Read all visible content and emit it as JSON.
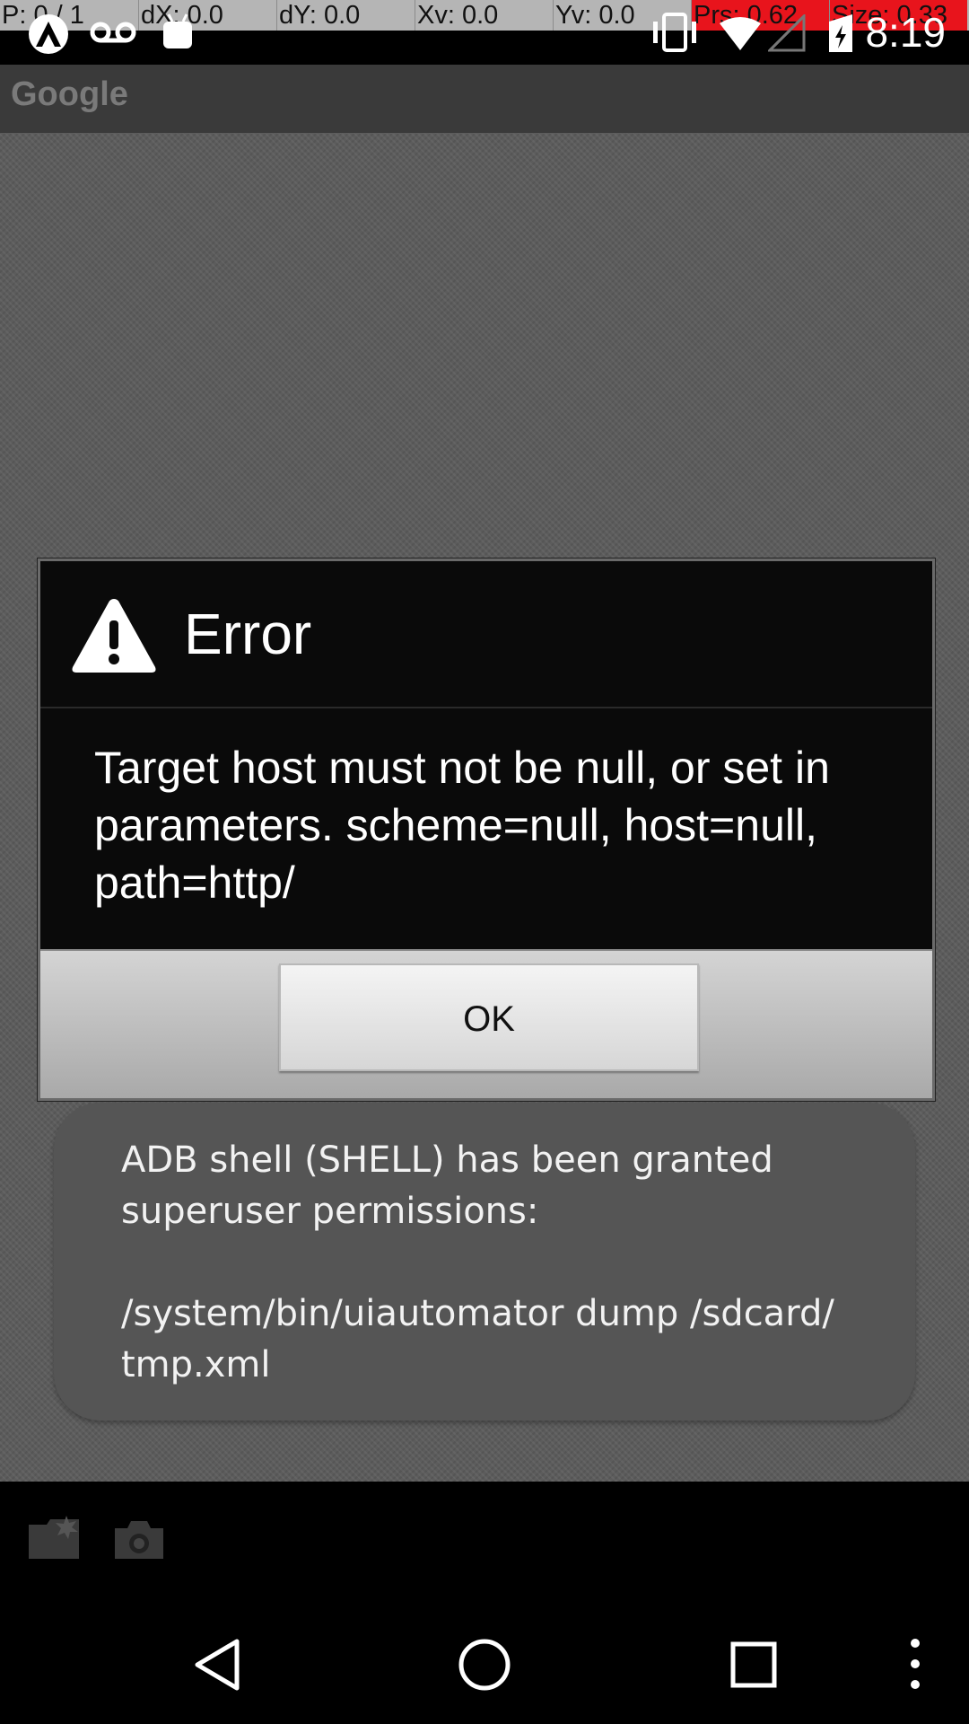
{
  "debug": {
    "cells": [
      {
        "text": "P: 0 / 1"
      },
      {
        "text": "dX: 0.0"
      },
      {
        "text": "dY: 0.0"
      },
      {
        "text": "Xv: 0.0"
      },
      {
        "text": "Yv: 0.0"
      },
      {
        "text": "Prs: 0.62",
        "highlight": true
      },
      {
        "text": "Size: 0.33",
        "highlight": true
      }
    ]
  },
  "status_bar": {
    "time": "8:19",
    "icons": [
      "notification-icon",
      "voicemail-icon",
      "android-debug-icon",
      "vibrate-icon",
      "wifi-icon",
      "no-signal-icon",
      "battery-charging-icon"
    ]
  },
  "action_bar": {
    "title": "Google"
  },
  "dialog": {
    "title": "Error",
    "message": "Target host must not be null, or set in parameters. scheme=null, host=null, path=http/",
    "ok_label": "OK",
    "icon": "warning-icon"
  },
  "toast": {
    "message": "ADB shell (SHELL) has been granted\nsuperuser permissions:\n\n/system/bin/uiautomator dump /sdcard/\ntmp.xml"
  },
  "bottom_bar": {
    "icons": [
      "folder-icon",
      "camera-icon"
    ]
  },
  "nav_bar": {
    "icons": [
      "back-icon",
      "home-icon",
      "recents-icon",
      "overflow-menu-icon"
    ]
  },
  "colors": {
    "dialog_bg": "#0a0a0a",
    "toast_bg": "#555555",
    "debug_highlight": "#e8141c"
  }
}
